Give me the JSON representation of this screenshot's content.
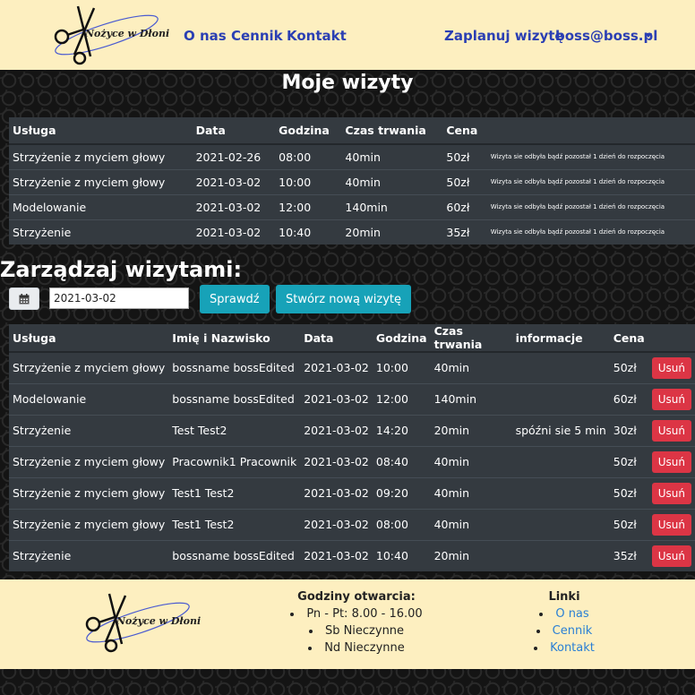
{
  "brand": {
    "logo_text": "Nożyce w Dłoni"
  },
  "nav": {
    "links": [
      "O nas",
      "Cennik",
      "Kontakt"
    ],
    "schedule": "Zaplanuj wizytę",
    "user": "boss@boss.pl"
  },
  "visits": {
    "title": "Moje wizyty",
    "headers": [
      "Usługa",
      "Data",
      "Godzina",
      "Czas trwania",
      "Cena",
      ""
    ],
    "rows": [
      [
        "Strzyżenie z myciem głowy",
        "2021-02-26",
        "08:00",
        "40min",
        "50zł",
        "Wizyta sie odbyła bądź pozostał 1 dzień do rozpoczęcia"
      ],
      [
        "Strzyżenie z myciem głowy",
        "2021-03-02",
        "10:00",
        "40min",
        "50zł",
        "Wizyta sie odbyła bądź pozostał 1 dzień do rozpoczęcia"
      ],
      [
        "Modelowanie",
        "2021-03-02",
        "12:00",
        "140min",
        "60zł",
        "Wizyta sie odbyła bądź pozostał 1 dzień do rozpoczęcia"
      ],
      [
        "Strzyżenie",
        "2021-03-02",
        "10:40",
        "20min",
        "35zł",
        "Wizyta sie odbyła bądź pozostał 1 dzień do rozpoczęcia"
      ]
    ]
  },
  "manage": {
    "title": "Zarządzaj wizytami:",
    "date_value": "2021-03-02",
    "check_label": "Sprawdź",
    "create_label": "Stwórz nową wizytę",
    "delete_label": "Usuń",
    "headers": [
      "Usługa",
      "Imię i Nazwisko",
      "Data",
      "Godzina",
      "Czas trwania",
      "informacje",
      "Cena",
      ""
    ],
    "rows": [
      [
        "Strzyżenie z myciem głowy",
        "bossname bossEdited",
        "2021-03-02",
        "10:00",
        "40min",
        "",
        "50zł"
      ],
      [
        "Modelowanie",
        "bossname bossEdited",
        "2021-03-02",
        "12:00",
        "140min",
        "",
        "60zł"
      ],
      [
        "Strzyżenie",
        "Test Test2",
        "2021-03-02",
        "14:20",
        "20min",
        "spóźni sie 5 min",
        "30zł"
      ],
      [
        "Strzyżenie z myciem głowy",
        "Pracownik1 Pracownik",
        "2021-03-02",
        "08:40",
        "40min",
        "",
        "50zł"
      ],
      [
        "Strzyżenie z myciem głowy",
        "Test1 Test2",
        "2021-03-02",
        "09:20",
        "40min",
        "",
        "50zł"
      ],
      [
        "Strzyżenie z myciem głowy",
        "Test1 Test2",
        "2021-03-02",
        "08:00",
        "40min",
        "",
        "50zł"
      ],
      [
        "Strzyżenie",
        "bossname bossEdited",
        "2021-03-02",
        "10:40",
        "20min",
        "",
        "35zł"
      ]
    ]
  },
  "footer": {
    "hours_title": "Godziny otwarcia:",
    "hours": [
      "Pn - Pt: 8.00 - 16.00",
      "Sb Nieczynne",
      "Nd Nieczynne"
    ],
    "links_title": "Linki",
    "links": [
      "O nas",
      "Cennik",
      "Kontakt"
    ]
  },
  "icons": {
    "logo": "scissors-logo-icon",
    "calendar": "calendar-icon",
    "dropdown": "caret-down-icon"
  },
  "colors": {
    "navbar_bg": "#fdefc0",
    "nav_link": "#2b3fb3",
    "table_bg": "#343a40",
    "info_button": "#17a2b8",
    "danger_button": "#dc3545",
    "footer_link": "#2a7fd4"
  }
}
